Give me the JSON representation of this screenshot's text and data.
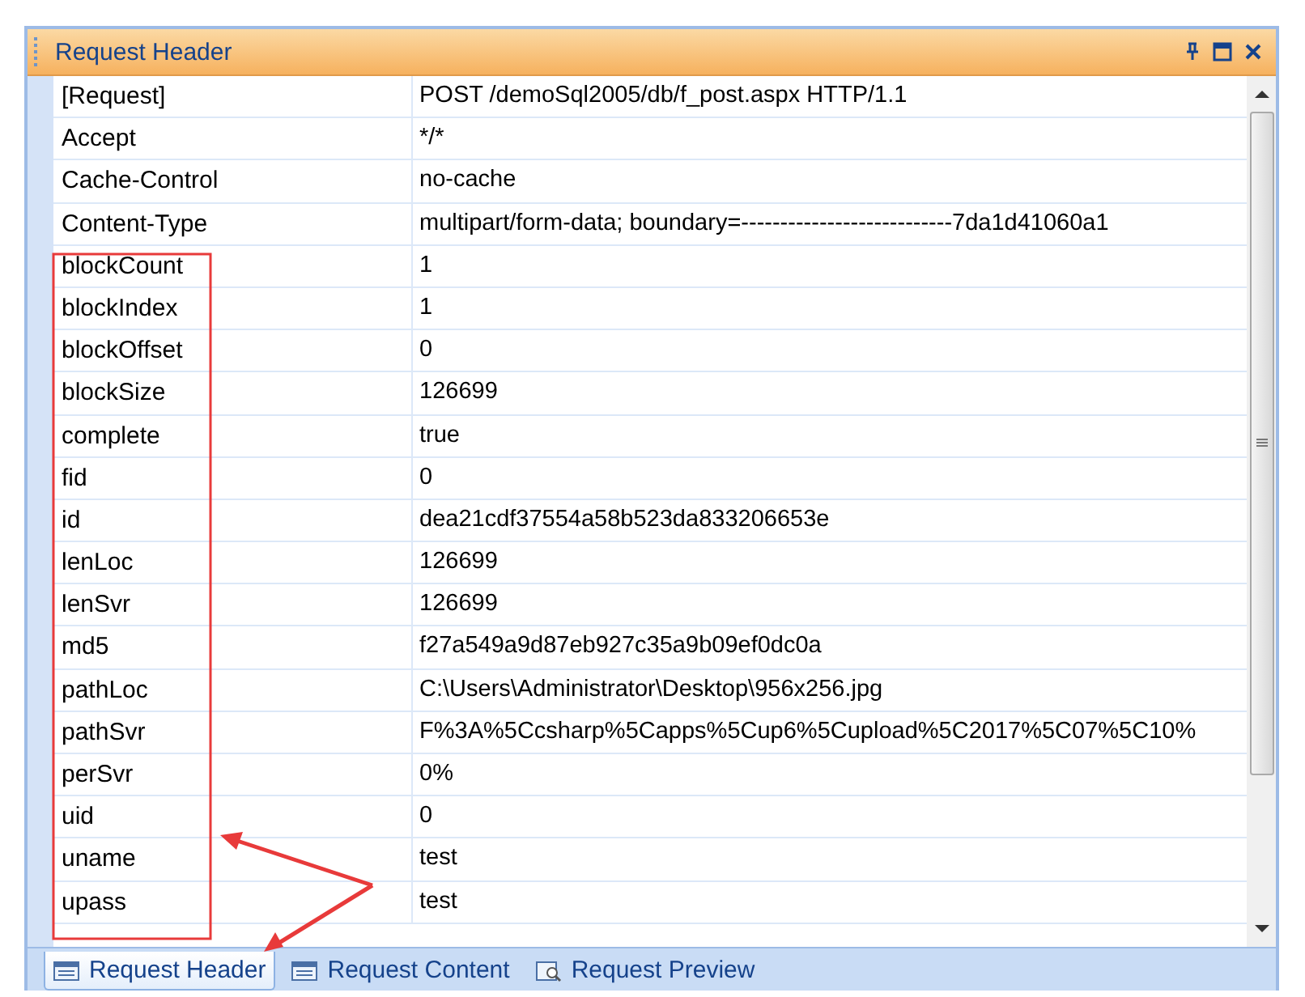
{
  "panel": {
    "title": "Request Header"
  },
  "rows": [
    {
      "name": "[Request]",
      "value": "POST /demoSql2005/db/f_post.aspx HTTP/1.1"
    },
    {
      "name": "Accept",
      "value": "*/*"
    },
    {
      "name": "Cache-Control",
      "value": "no-cache"
    },
    {
      "name": "Content-Type",
      "value": "multipart/form-data; boundary=---------------------------7da1d41060a1"
    },
    {
      "name": "blockCount",
      "value": "1"
    },
    {
      "name": "blockIndex",
      "value": "1"
    },
    {
      "name": "blockOffset",
      "value": "0"
    },
    {
      "name": "blockSize",
      "value": "126699"
    },
    {
      "name": "complete",
      "value": "true"
    },
    {
      "name": "fid",
      "value": "0"
    },
    {
      "name": "id",
      "value": "dea21cdf37554a58b523da833206653e"
    },
    {
      "name": "lenLoc",
      "value": "126699"
    },
    {
      "name": "lenSvr",
      "value": "126699"
    },
    {
      "name": "md5",
      "value": "f27a549a9d87eb927c35a9b09ef0dc0a"
    },
    {
      "name": "pathLoc",
      "value": "C:\\Users\\Administrator\\Desktop\\956x256.jpg"
    },
    {
      "name": "pathSvr",
      "value": "F%3A%5Ccsharp%5Capps%5Cup6%5Cupload%5C2017%5C07%5C10%"
    },
    {
      "name": "perSvr",
      "value": "0%"
    },
    {
      "name": "uid",
      "value": "0"
    },
    {
      "name": "uname",
      "value": "test"
    },
    {
      "name": "upass",
      "value": "test"
    }
  ],
  "tabs": [
    {
      "label": "Request Header",
      "selected": true,
      "kind": "list"
    },
    {
      "label": "Request Content",
      "selected": false,
      "kind": "list"
    },
    {
      "label": "Request Preview",
      "selected": false,
      "kind": "preview"
    }
  ]
}
